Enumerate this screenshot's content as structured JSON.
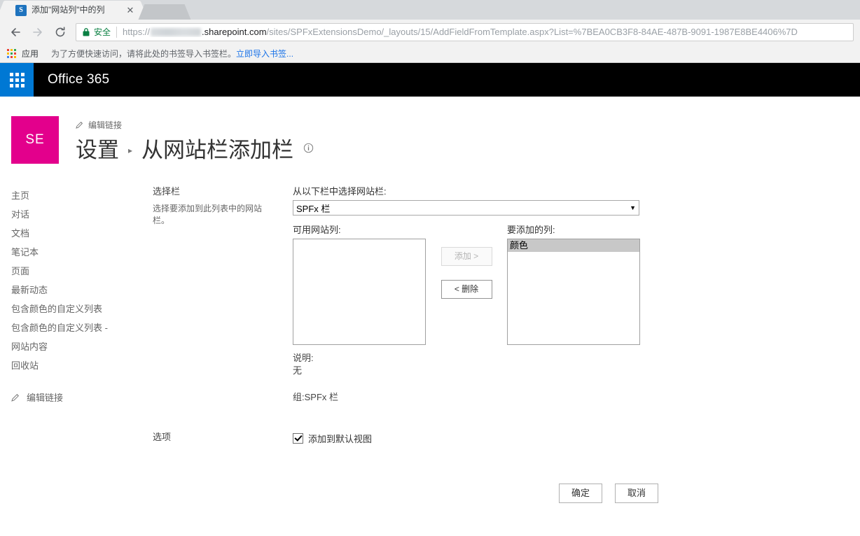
{
  "browser": {
    "tab": {
      "favicon": "sharepoint-icon",
      "title": "添加\"网站列\"中的列",
      "close_label": "✕"
    },
    "new_tab_label": "",
    "nav": {
      "back": "back-arrow-icon",
      "forward": "forward-arrow-icon",
      "reload": "reload-icon"
    },
    "omnibox": {
      "secure_label": "安全",
      "url_scheme": "https://",
      "url_host_redacted": "",
      "url_host_main": ".sharepoint.com",
      "url_path": "/sites/SPFxExtensionsDemo/_layouts/15/AddFieldFromTemplate.aspx?List=%7BEA0CB3F8-84AE-487B-9091-1987E8BE4406%7D"
    },
    "bookmarks": {
      "apps_label": "应用",
      "hint": "为了方便快速访问，请将此处的书签导入书签栏。",
      "import_link": "立即导入书签..."
    }
  },
  "suitebar": {
    "waffle_label": "waffle-icon",
    "title": "Office 365"
  },
  "page": {
    "site_logo_text": "SE",
    "edit_links_top": "编辑链接",
    "breadcrumb": {
      "parent": "设置",
      "separator": "▸",
      "current": "从网站栏添加栏"
    },
    "info_icon": "info-icon"
  },
  "sidebar": {
    "items": [
      {
        "label": "主页"
      },
      {
        "label": "对话"
      },
      {
        "label": "文档"
      },
      {
        "label": "笔记本"
      },
      {
        "label": "页面"
      },
      {
        "label": "最新动态"
      },
      {
        "label": "包含颜色的自定义列表"
      },
      {
        "label": "包含颜色的自定义列表 -"
      },
      {
        "label": "网站内容"
      },
      {
        "label": "回收站"
      }
    ],
    "edit_links": "编辑链接"
  },
  "form": {
    "select_section": {
      "title": "选择栏",
      "description": "选择要添加到此列表中的网站栏。"
    },
    "group_label": "从以下栏中选择网站栏:",
    "group_value": "SPFx 栏",
    "group_caret": "▼",
    "available_label": "可用网站列:",
    "available_options": [],
    "add_button": "添加 >",
    "add_button_disabled": true,
    "remove_button": "< 删除",
    "remove_button_disabled": false,
    "selected_label": "要添加的列:",
    "selected_options": [
      {
        "label": "颜色",
        "selected": true
      }
    ],
    "description_label": "说明:",
    "description_value": "无",
    "group_info": "组:SPFx 栏",
    "options_section": {
      "title": "选项",
      "checkbox_label": "添加到默认视图",
      "checkbox_checked": true
    },
    "ok_button": "确定",
    "cancel_button": "取消"
  },
  "colors": {
    "accent": "#e3008c",
    "suite_bar": "#000000",
    "waffle": "#0078d4",
    "secure_green": "#0b8043",
    "link_blue": "#1a73e8",
    "selection_grey": "#c8c8c8"
  }
}
